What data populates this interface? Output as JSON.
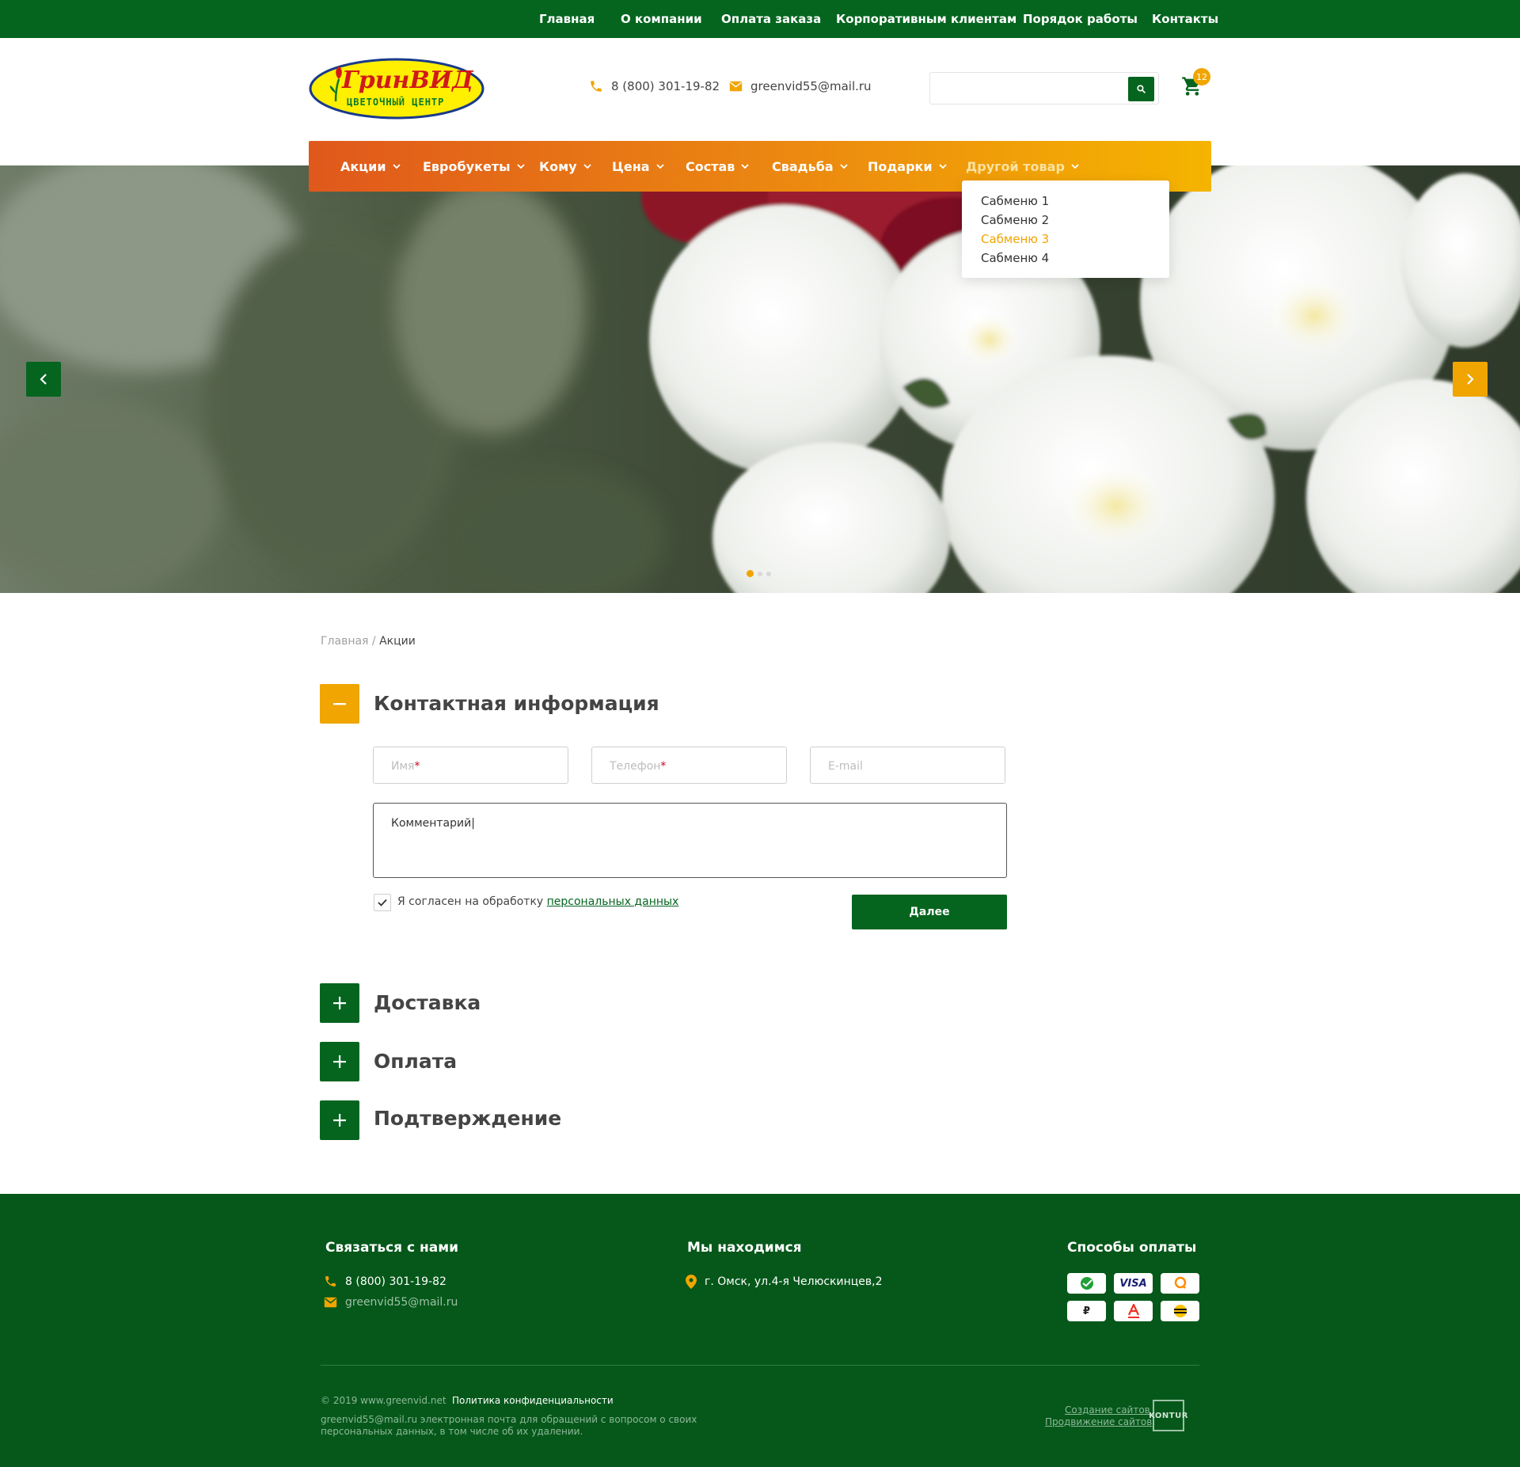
{
  "topnav": {
    "items": [
      "Главная",
      "О компании",
      "Оплата заказа",
      "Корпоративным клиентам",
      "Порядок работы",
      "Контакты"
    ]
  },
  "header": {
    "logo_name": "ГринВИД",
    "logo_sub": "ЦВЕТОЧНЫЙ ЦЕНТР",
    "phone": "8 (800) 301-19-82",
    "email": "greenvid55@mail.ru",
    "search_placeholder": "",
    "cart_count": "12"
  },
  "mainmenu": {
    "items": [
      "Акции",
      "Евробукеты",
      "Кому",
      "Цена",
      "Состав",
      "Свадьба",
      "Подарки",
      "Другой товар"
    ]
  },
  "dropdown": {
    "items": [
      "Сабменю 1",
      "Сабменю 2",
      "Сабменю 3",
      "Сабменю 4"
    ]
  },
  "breadcrumb": {
    "home": "Главная",
    "separator": " / ",
    "current": "Акции"
  },
  "form": {
    "section_title": "Контактная информация",
    "name_label": "Имя",
    "phone_label": "Телефон",
    "email_label": "E-mail",
    "required_mark": "*",
    "comment_value": "Комментарий|",
    "consent_text": "Я согласен на обработку ",
    "consent_link": "персональных данных",
    "consent_checked": true,
    "next_button": "Далее"
  },
  "sections": {
    "delivery": "Доставка",
    "payment": "Оплата",
    "confirmation": "Подтверждение"
  },
  "footer": {
    "contact_heading": "Связаться с нами",
    "phone": "8 (800) 301-19-82",
    "email": "greenvid55@mail.ru",
    "location_heading": "Мы находимся",
    "address": "г. Омск, ул.4-я Челюскинцев,2",
    "payment_heading": "Способы оплаты",
    "copyright": "© 2019 www.greenvid.net",
    "privacy": "Политика конфиденциальности",
    "note_email": "greenvid55@mail.ru",
    "note_line1": " электронная почта для обращений с вопросом о своих",
    "note_line2": "персональных данных, в том числе об их удалении.",
    "dev_link1": "Создание сайтов",
    "dev_link2": "Продвижение сайтов",
    "dev_logo": "KONTUR"
  },
  "colors": {
    "brand_green": "#05651f",
    "accent_orange": "#f0a500",
    "menu_gradient_start": "#e0581c",
    "footer_bg": "#05581a"
  }
}
